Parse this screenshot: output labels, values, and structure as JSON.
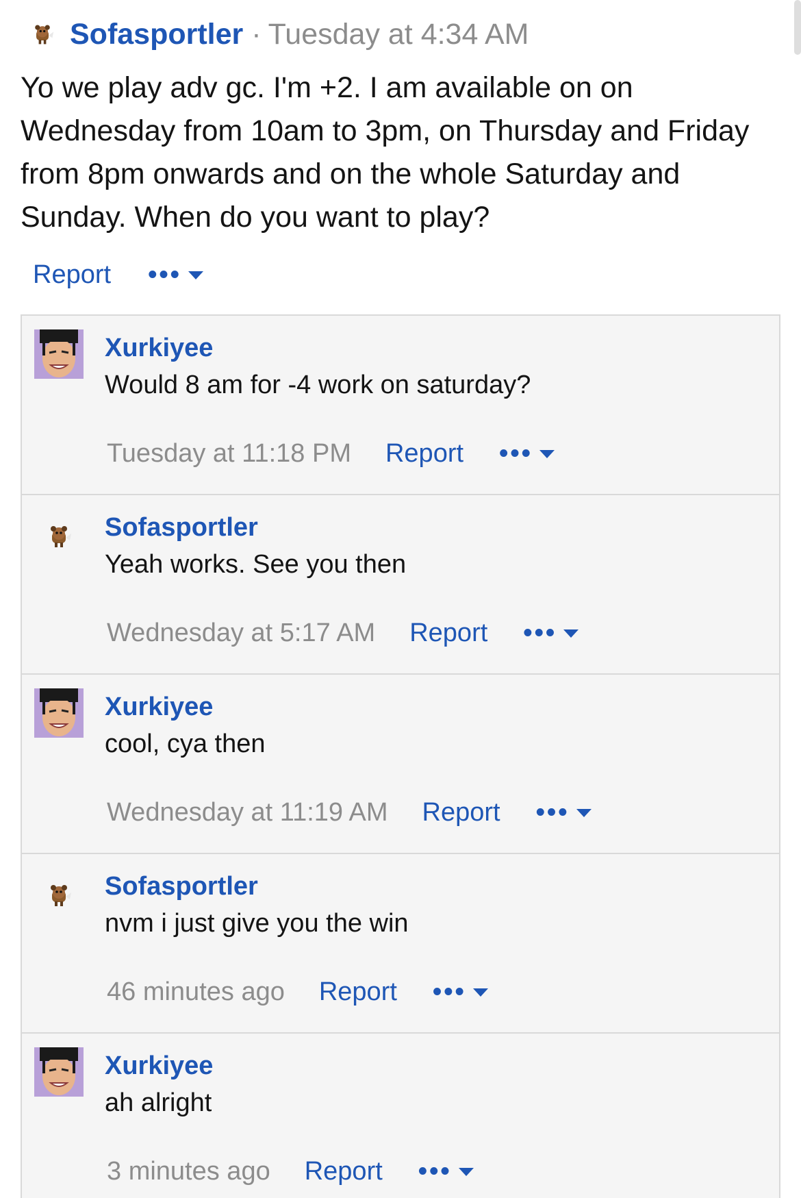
{
  "post": {
    "author": "Sofasportler",
    "separator": "·",
    "time": "Tuesday at 4:34 AM",
    "body": "Yo we play adv gc. I'm +2. I am available on on Wednesday from 10am to 3pm, on Thursday and Friday from 8pm onwards and on the whole Saturday and Sunday. When do you want to play?",
    "report_label": "Report",
    "more_label": "•••"
  },
  "comments": [
    {
      "author": "Xurkiyee",
      "avatar": "anime-face-avatar",
      "text": "Would 8 am for -4 work on saturday?",
      "time": "Tuesday at 11:18 PM",
      "report_label": "Report",
      "more_label": "•••"
    },
    {
      "author": "Sofasportler",
      "avatar": "fox-avatar",
      "text": "Yeah works. See you then",
      "time": "Wednesday at 5:17 AM",
      "report_label": "Report",
      "more_label": "•••"
    },
    {
      "author": "Xurkiyee",
      "avatar": "anime-face-avatar",
      "text": "cool, cya then",
      "time": "Wednesday at 11:19 AM",
      "report_label": "Report",
      "more_label": "•••"
    },
    {
      "author": "Sofasportler",
      "avatar": "fox-avatar",
      "text": "nvm i just give you the win",
      "time": "46 minutes ago",
      "report_label": "Report",
      "more_label": "•••"
    },
    {
      "author": "Xurkiyee",
      "avatar": "anime-face-avatar",
      "text": "ah alright",
      "time": "3 minutes ago",
      "report_label": "Report",
      "more_label": "•••"
    }
  ],
  "colors": {
    "link": "#1e56b5",
    "muted": "#8c8c8c",
    "panel": "#f5f5f5",
    "border": "#d9d9d9"
  }
}
